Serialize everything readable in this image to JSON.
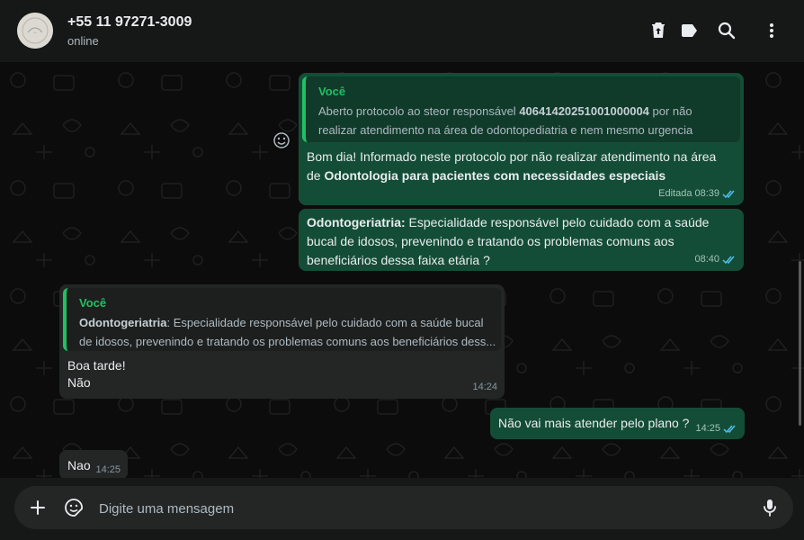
{
  "header": {
    "contact_name": "+55 11 97271-3009",
    "status": "online",
    "icons": [
      "archive-icon",
      "label-icon",
      "search-icon",
      "more-menu-icon"
    ]
  },
  "messages": [
    {
      "direction": "outgoing",
      "quote": {
        "author": "Você",
        "text_before": "Aberto protocolo ao steor responsável ",
        "text_bold": "40641420251001000004",
        "text_after": " por não realizar atendimento na área de odontopediatria e nem mesmo urgencia"
      },
      "text_before": "Bom dia! Informado neste protocolo por não realizar atendimento na área de ",
      "text_bold": "Odontologia para pacientes com necessidades especiais",
      "edited_label": "Editada",
      "time": "08:39",
      "status": "read"
    },
    {
      "direction": "outgoing",
      "text_bold": "Odontogeriatria:",
      "text_after": " Especialidade responsável pelo cuidado com a saúde bucal de idosos, prevenindo e tratando os problemas comuns aos beneficiários dessa faixa etária ?",
      "time": "08:40",
      "status": "read"
    },
    {
      "direction": "incoming",
      "quote": {
        "author": "Você",
        "text_bold": "Odontogeriatria",
        "text_after": ": Especialidade responsável pelo cuidado com a saúde bucal de idosos, prevenindo e tratando os problemas comuns aos beneficiários dess..."
      },
      "line1": "Boa tarde!",
      "line2": "Não",
      "time": "14:24"
    },
    {
      "direction": "outgoing",
      "text": "Não vai mais atender pelo plano ?",
      "time": "14:25",
      "status": "read"
    },
    {
      "direction": "incoming",
      "text": "Nao",
      "time": "14:25"
    }
  ],
  "composer": {
    "placeholder": "Digite uma mensagem",
    "icons": [
      "plus-icon",
      "sticker-icon",
      "microphone-icon"
    ]
  },
  "colors": {
    "outgoing_bubble": "#144d37",
    "incoming_bubble": "#242626",
    "accent": "#21c063",
    "read_ticks": "#53bdeb"
  }
}
